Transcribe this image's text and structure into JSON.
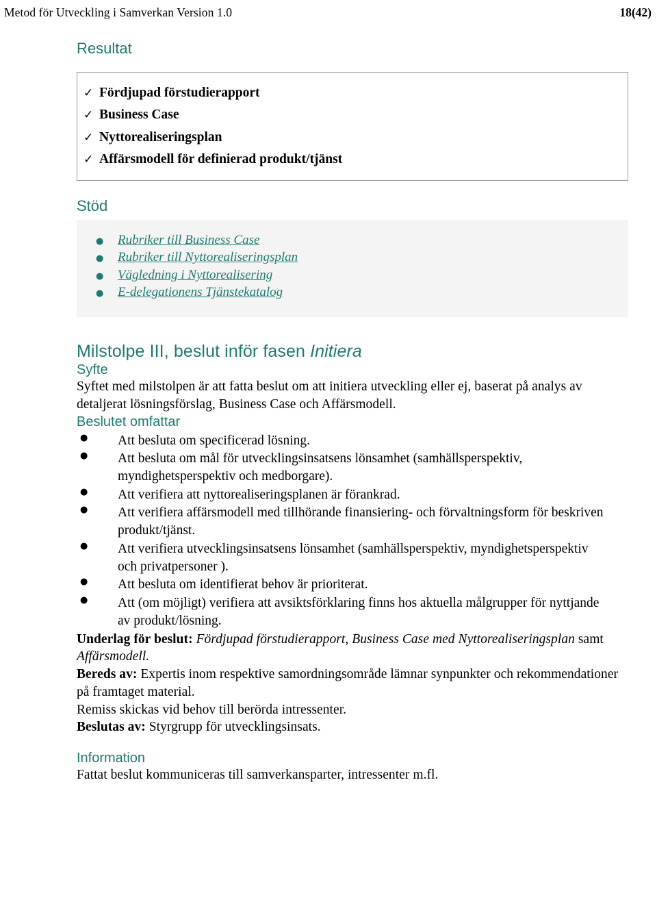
{
  "header": {
    "title": "Metod för Utveckling i Samverkan Version 1.0",
    "page_number": "18(42)"
  },
  "result": {
    "heading": "Resultat",
    "check_icon": "check-icon",
    "items": [
      "Fördjupad förstudierapport",
      "Business Case",
      "Nyttorealiseringsplan",
      "Affärsmodell för definierad produkt/tjänst"
    ]
  },
  "support": {
    "heading": "Stöd",
    "bullet_icon": "bullet-dot-icon",
    "links": [
      "Rubriker till Business Case",
      "Rubriker till Nyttorealiseringsplan",
      "Vägledning i Nyttorealisering",
      "E-delegationens Tjänstekatalog"
    ]
  },
  "milestone": {
    "heading_main": "Milstolpe III, beslut inför fasen ",
    "heading_italic": "Initiera",
    "purpose": {
      "heading": "Syfte",
      "text": "Syftet med milstolpen är att fatta beslut om att initiera utveckling eller ej, baserat på analys av detaljerat lösningsförslag, Business Case och Affärsmodell."
    },
    "decision": {
      "heading": "Beslutet omfattar",
      "bullet_icon": "bullet-dot-icon",
      "items": [
        "Att besluta om specificerad lösning.",
        "Att besluta om mål för utvecklingsinsatsens lönsamhet (samhällsperspektiv, myndighetsperspektiv och medborgare).",
        "Att verifiera att nyttorealiseringsplanen är förankrad.",
        "Att verifiera affärsmodell med tillhörande finansiering- och förvaltningsform för beskriven produkt/tjänst.",
        "Att verifiera utvecklingsinsatsens lönsamhet (samhällsperspektiv, myndighetsperspektiv och privatpersoner ).",
        "Att besluta om identifierat behov är prioriterat.",
        "Att (om möjligt) verifiera att avsiktsförklaring finns hos aktuella målgrupper för nyttjande av produkt/lösning."
      ]
    },
    "basis": {
      "label": "Underlag för beslut:",
      "italic_part_1": "Fördjupad förstudierapport",
      "separator_1": ", ",
      "italic_part_2": "Business Case med Nyttorealiseringsplan",
      "plain_part": " samt ",
      "italic_part_3": "Affärsmodell."
    },
    "prepared": {
      "label": "Bereds av:",
      "text": " Expertis inom respektive samordningsområde lämnar synpunkter och rekommendationer på framtaget material.",
      "remiss": "Remiss skickas vid behov till berörda intressenter."
    },
    "decided_by": {
      "label": "Beslutas av:",
      "text": " Styrgrupp för utvecklingsinsats."
    },
    "information": {
      "heading": "Information",
      "text": "Fattat beslut kommuniceras till samverkansparter, intressenter m.fl."
    }
  },
  "colors": {
    "accent_teal": "#1d7a70",
    "panel_gray": "#f4f4f4",
    "box_border": "#9a9a9a"
  },
  "glyphs": {
    "check": "✓",
    "bullet": "●",
    "bullet_small": "•"
  }
}
